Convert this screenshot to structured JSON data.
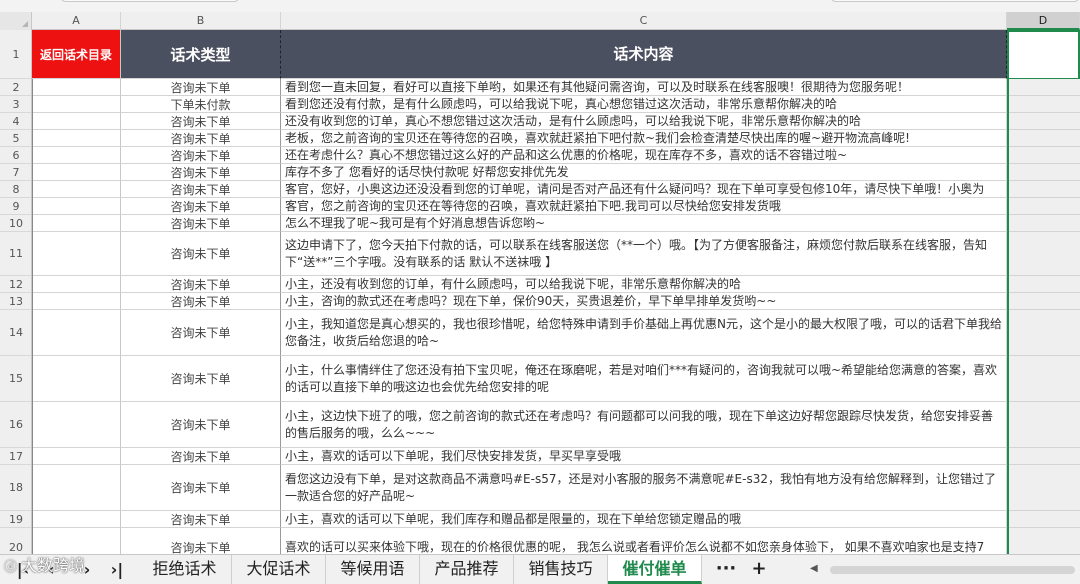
{
  "columns": [
    "A",
    "B",
    "C",
    "D"
  ],
  "header_row": {
    "row_num": "1",
    "a": "返回话术目录",
    "b": "话术类型",
    "c": "话术内容"
  },
  "rows": [
    {
      "n": "2",
      "type": "咨询未下单",
      "content": "看到您一直未回复，看好可以直接下单哟，如果还有其他疑问需咨询，可以及时联系在线客服噢！很期待为您服务呢！"
    },
    {
      "n": "3",
      "type": "下单未付款",
      "content": "看到您还没有付款，是有什么顾虑吗，可以给我说下呢，真心想您错过这次活动，非常乐意帮你解决的哈"
    },
    {
      "n": "4",
      "type": "咨询未下单",
      "content": "还没有收到您的订单，真心不想您错过这次活动，是有什么顾虑吗，可以给我说下呢，非常乐意帮你解决的哈"
    },
    {
      "n": "5",
      "type": "咨询未下单",
      "content": "老板，您之前咨询的宝贝还在等待您的召唤，喜欢就赶紧拍下吧付款~我们会检查清楚尽快出库的喔~避开物流高峰呢!"
    },
    {
      "n": "6",
      "type": "咨询未下单",
      "content": "还在考虑什么？真心不想您错过这么好的产品和这么优惠的价格呢，现在库存不多，喜欢的话不容错过啦~"
    },
    {
      "n": "7",
      "type": "咨询未下单",
      "content": "库存不多了 您看好的话尽快付款呢 好帮您安排优先发"
    },
    {
      "n": "8",
      "type": "咨询未下单",
      "content": "客官，您好，小奥这边还没没看到您的订单呢，请问是否对产品还有什么疑问吗？现在下单可享受包修10年，请尽快下单哦！小奥为"
    },
    {
      "n": "9",
      "type": "咨询未下单",
      "content": "客官，您之前咨询的宝贝还在等待您的召唤，喜欢就赶紧拍下吧.我司可以尽快给您安排发货哦"
    },
    {
      "n": "10",
      "type": "咨询未下单",
      "content": "怎么不理我了呢~我可是有个好消息想告诉您哟~"
    },
    {
      "n": "11",
      "type": "咨询未下单",
      "content": "这边申请下了，您今天拍下付款的话，可以联系在线客服送您（**一个）哦。【为了方便客服备注，麻烦您付款后联系在线客服，告知下“送**”三个字哦。没有联系的话 默认不送袜哦 】"
    },
    {
      "n": "12",
      "type": "咨询未下单",
      "content": "小主，还没有收到您的订单，有什么顾虑吗，可以给我说下呢，非常乐意帮你解决的哈"
    },
    {
      "n": "13",
      "type": "咨询未下单",
      "content": "小主，咨询的款式还在考虑吗？现在下单，保价90天，买贵退差价，早下单早排单发货哟~~"
    },
    {
      "n": "14",
      "type": "咨询未下单",
      "content": "小主，我知道您是真心想买的，我也很珍惜呢，给您特殊申请到手价基础上再优惠N元，这个是小的最大权限了哦，可以的话君下单我给您备注，收货后给您退的哈~"
    },
    {
      "n": "15",
      "type": "咨询未下单",
      "content": "小主，什么事情绊住了您还没有拍下宝贝呢，俺还在琢磨呢，若是对咱们***有疑问的，咨询我就可以哦~希望能给您满意的答案，喜欢的话可以直接下单的哦这边也会优先给您安排的呢"
    },
    {
      "n": "16",
      "type": "咨询未下单",
      "content": "小主，这边快下班了的哦，您之前咨询的款式还在考虑吗？有问题都可以问我的哦，现在下单这边好帮您跟踪尽快发货，给您安排妥善的售后服务的哦，么么~~~"
    },
    {
      "n": "17",
      "type": "咨询未下单",
      "content": "小主，喜欢的话可以下单呢，我们尽快安排发货，早买早享受哦"
    },
    {
      "n": "18",
      "type": "咨询未下单",
      "content": "看您这边没有下单，是对这款商品不满意吗#E-s57，还是对小客服的服务不满意呢#E-s32，我怕有地方没有给您解释到，让您错过了一款适合您的好产品呢~"
    },
    {
      "n": "19",
      "type": "咨询未下单",
      "content": "小主，喜欢的话可以下单呢，我们库存和赠品都是限量的，现在下单给您锁定赠品的哦"
    },
    {
      "n": "20",
      "type": "咨询未下单",
      "content": "喜欢的话可以买来体验下哦，现在的价格很优惠的呢， 我怎么说或者看评价怎么说都不如您亲身体验下， 如果不喜欢咱家也是支持7"
    }
  ],
  "tabs": [
    {
      "label": "拒绝话术",
      "active": false
    },
    {
      "label": "大促话术",
      "active": false
    },
    {
      "label": "等候用语",
      "active": false
    },
    {
      "label": "产品推荐",
      "active": false
    },
    {
      "label": "销售技巧",
      "active": false
    },
    {
      "label": "催付催单",
      "active": true
    }
  ],
  "tab_more": "···",
  "tab_add": "+",
  "nav": {
    "first": "|‹",
    "prev": "‹",
    "next": "›",
    "last": "›|"
  },
  "watermark": "大数跨境",
  "colors": {
    "accent": "#1f8a4c",
    "header_bg": "#4b5060",
    "return_btn": "#ee1111"
  }
}
